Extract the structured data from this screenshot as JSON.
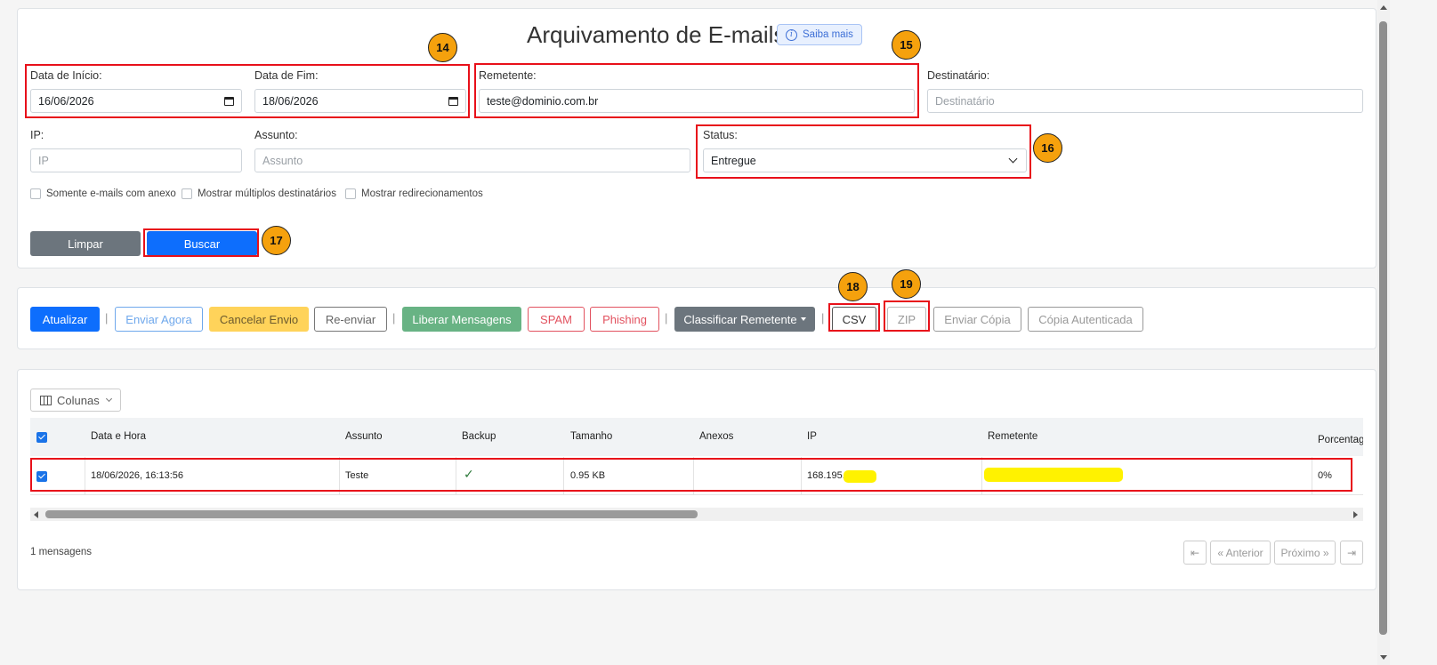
{
  "header": {
    "title": "Arquivamento de E-mails",
    "saiba_mais": "Saiba mais",
    "info_icon": "info-circle-icon"
  },
  "filters": {
    "data_inicio": {
      "label": "Data de Início:",
      "value": "16/06/2026"
    },
    "data_fim": {
      "label": "Data de Fim:",
      "value": "18/06/2026"
    },
    "remetente": {
      "label": "Remetente:",
      "value": "teste@dominio.com.br"
    },
    "destinatario": {
      "label": "Destinatário:",
      "placeholder": "Destinatário"
    },
    "ip": {
      "label": "IP:",
      "placeholder": "IP"
    },
    "assunto": {
      "label": "Assunto:",
      "placeholder": "Assunto"
    },
    "status": {
      "label": "Status:",
      "value": "Entregue"
    },
    "checkboxes": [
      {
        "label": "Somente e-mails com anexo",
        "checked": false
      },
      {
        "label": "Mostrar múltiplos destinatários",
        "checked": false
      },
      {
        "label": "Mostrar redirecionamentos",
        "checked": false
      }
    ],
    "limpar": "Limpar",
    "buscar": "Buscar"
  },
  "toolbar": {
    "atualizar": "Atualizar",
    "enviar_agora": "Enviar Agora",
    "cancelar_envio": "Cancelar Envio",
    "reenviar": "Re-enviar",
    "liberar": "Liberar Mensagens",
    "spam": "SPAM",
    "phishing": "Phishing",
    "classificar": "Classificar Remetente",
    "csv": "CSV",
    "zip": "ZIP",
    "enviar_copia": "Enviar Cópia",
    "copia_autenticada": "Cópia Autenticada",
    "separator": "|"
  },
  "table": {
    "colunas_button": "Colunas",
    "headers": [
      "Data e Hora",
      "Assunto",
      "Backup",
      "Tamanho",
      "Anexos",
      "IP",
      "Remetente",
      "Porcentage"
    ],
    "rows": [
      {
        "checked": true,
        "data_hora": "18/06/2026, 16:13:56",
        "assunto": "Teste",
        "backup": "✓",
        "tamanho": "0.95 KB",
        "anexos": "",
        "ip": "168.195.",
        "remetente": "",
        "porcentagem": "0%"
      }
    ]
  },
  "footer": {
    "count": "1 mensagens",
    "first": "⇤",
    "anterior": "« Anterior",
    "proximo": "Próximo »",
    "last": "⇥"
  },
  "annotations": [
    "14",
    "15",
    "16",
    "17",
    "18",
    "19"
  ],
  "colors": {
    "highlight": "#e8101a",
    "badge": "#f5a10d",
    "primary": "#0d6efd",
    "redaction": "#fff200"
  }
}
